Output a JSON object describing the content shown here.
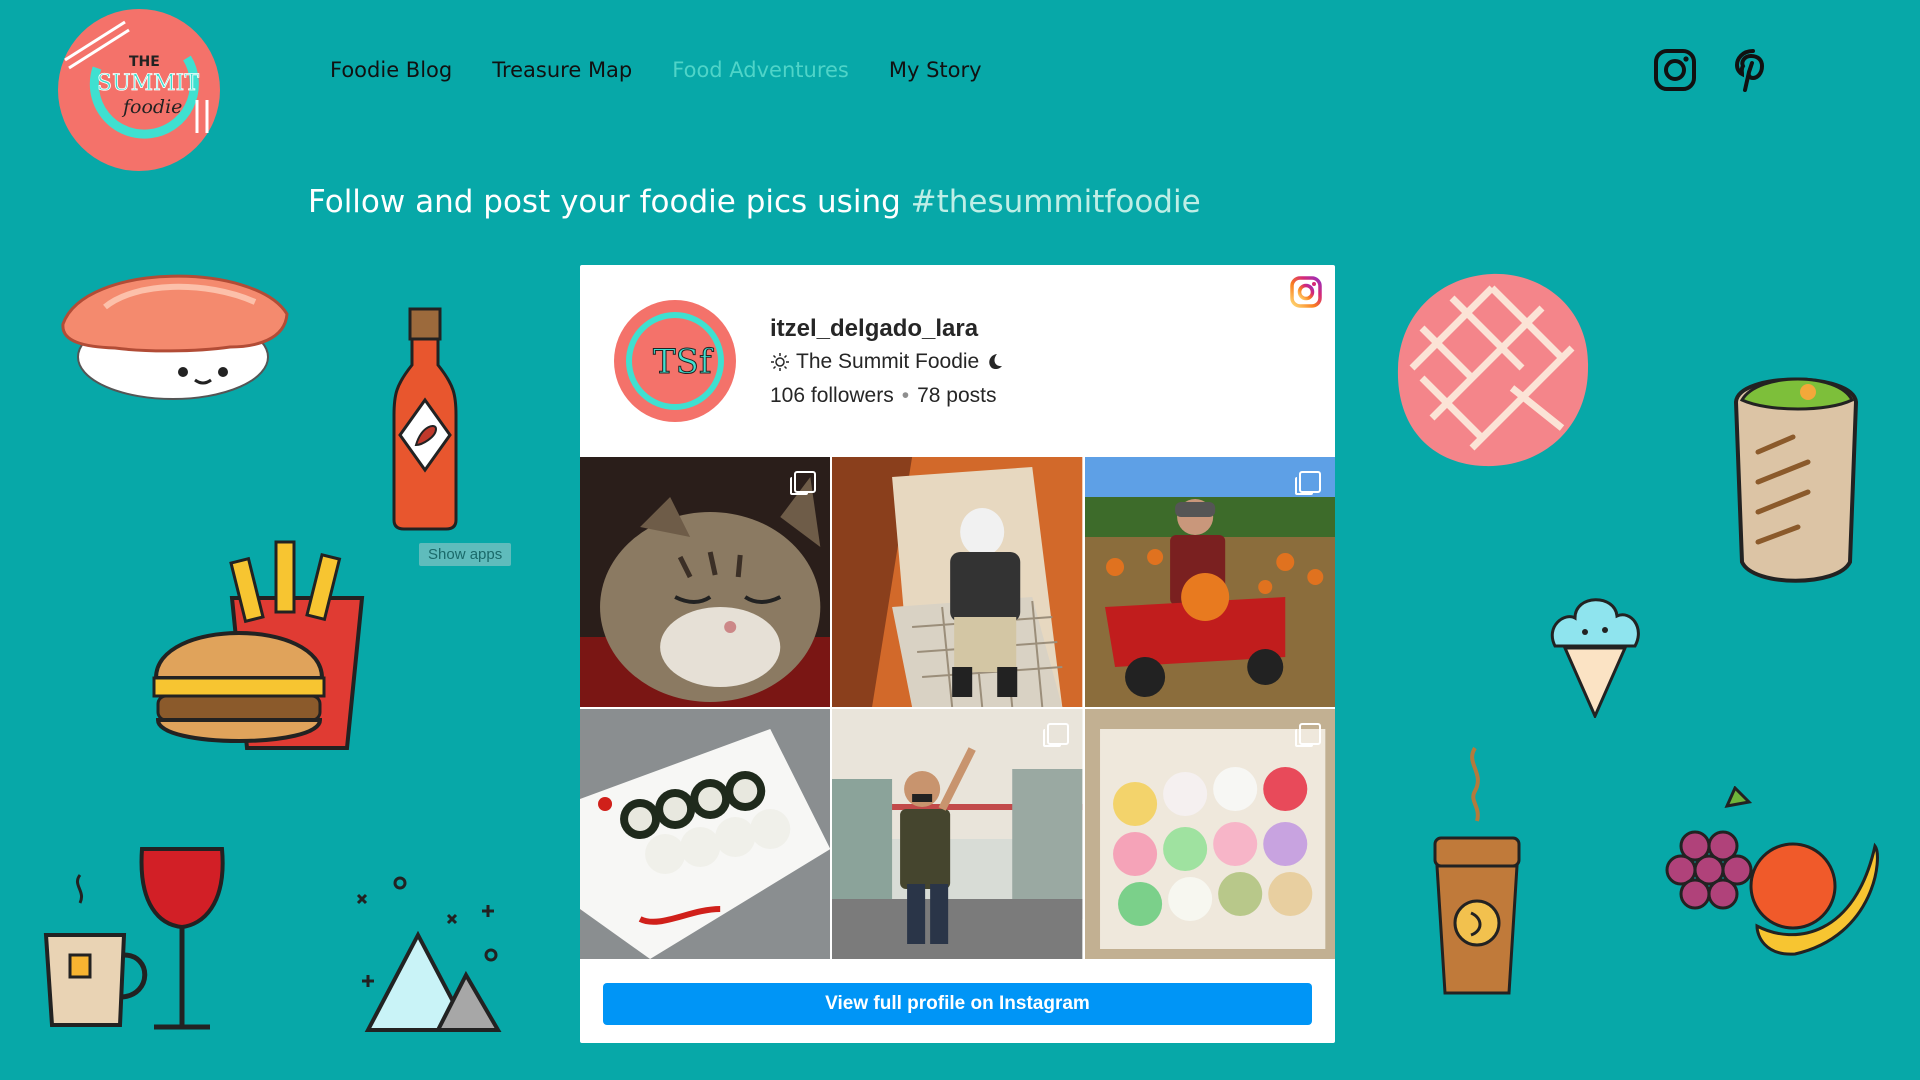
{
  "nav": {
    "items": [
      {
        "label": "Foodie Blog",
        "active": false
      },
      {
        "label": "Treasure Map",
        "active": false
      },
      {
        "label": "Food Adventures",
        "active": true
      },
      {
        "label": "My Story",
        "active": false
      }
    ]
  },
  "logo": {
    "line1": "THE",
    "line2": "SUMMIT",
    "line3": "foodie"
  },
  "social": {
    "instagram_icon": "instagram-icon",
    "pinterest_icon": "pinterest-icon"
  },
  "tagline": {
    "text": "Follow and post your foodie pics using ",
    "hashtag": "#thesummitfoodie"
  },
  "instagram": {
    "username": "itzel_delgado_lara",
    "bio": "The Summit Foodie",
    "followers": "106 followers",
    "posts": "78 posts",
    "separator": "•",
    "avatar_initials": "TSf",
    "button_label": "View full profile on Instagram",
    "grid": [
      {
        "subject": "cat",
        "multi": true
      },
      {
        "subject": "mirror-selfie",
        "multi": false
      },
      {
        "subject": "pumpkin-patch",
        "multi": true
      },
      {
        "subject": "sushi-platter",
        "multi": false
      },
      {
        "subject": "restroom-selfie",
        "multi": true
      },
      {
        "subject": "mochi-box",
        "multi": true
      }
    ]
  },
  "tooltip": {
    "show_apps": "Show apps"
  },
  "colors": {
    "background": "#07a8a8",
    "accent": "#f4726a",
    "button": "#0095f6",
    "active_nav": "#4fd4c8"
  },
  "decorations": [
    "sushi-icon",
    "hot-sauce-icon",
    "burger-fries-icon",
    "tea-wine-icon",
    "mountains-icon",
    "concha-bread-icon",
    "burrito-icon",
    "ice-cream-icon",
    "coffee-cup-icon",
    "fruit-icon"
  ]
}
